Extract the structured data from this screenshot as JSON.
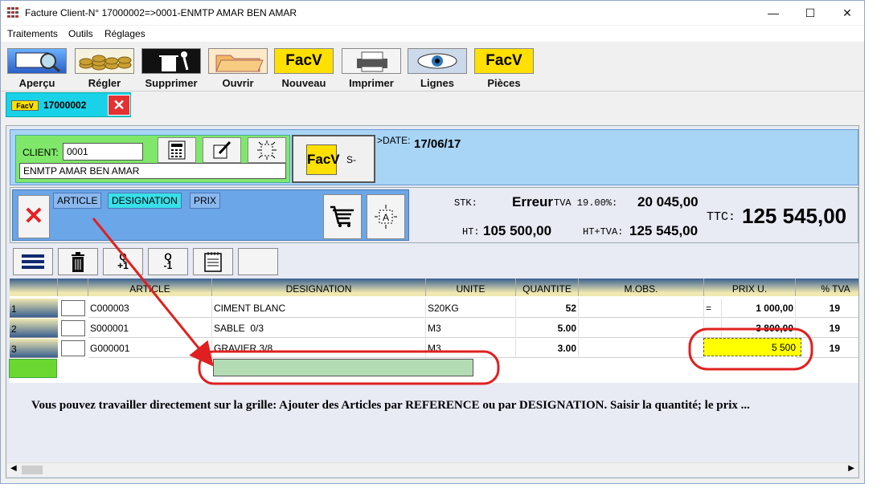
{
  "window": {
    "title": "Facture Client-N° 17000002=>0001-ENMTP AMAR BEN AMAR",
    "minimize": "—",
    "maximize": "☐",
    "close": "✕"
  },
  "menu": [
    "Traitements",
    "Outils",
    "Réglages"
  ],
  "toolbar": [
    {
      "label": "Aperçu",
      "icon": "magnifier-icon"
    },
    {
      "label": "Régler",
      "icon": "coins-icon"
    },
    {
      "label": "Supprimer",
      "icon": "trash-icon"
    },
    {
      "label": "Ouvrir",
      "icon": "folder-icon"
    },
    {
      "label": "Nouveau",
      "icon": "facv-icon",
      "badge": "FacV"
    },
    {
      "label": "Imprimer",
      "icon": "printer-icon"
    },
    {
      "label": "Lignes",
      "icon": "eye-icon"
    },
    {
      "label": "Pièces",
      "icon": "facv-icon",
      "badge": "FacV"
    }
  ],
  "doc_tab": {
    "badge": "FacV",
    "label": "17000002",
    "close": "✕"
  },
  "client": {
    "label": "CLIENT:",
    "code": "0001",
    "name": "ENMTP AMAR BEN AMAR",
    "facv_badge": "FacV",
    "facv_suffix": "S-",
    "date_label": ">DATE:",
    "date_value": "17/06/17"
  },
  "search_tabs": [
    "ARTICLE",
    "DESIGNATION",
    "PRIX"
  ],
  "totals": {
    "stk_label": "STK:",
    "stk_value": "Erreur",
    "tva_label": "TVA 19.00%:",
    "tva_value": "20 045,00",
    "ht_label": "HT:",
    "ht_value": "105 500,00",
    "ht_tva_label": "HT+TVA:",
    "ht_tva_value": "125 545,00",
    "ttc_label": "TTC:",
    "ttc_value": "125 545,00"
  },
  "grid_buttons": {
    "qplus": "Q\n+1",
    "qminus": "Q\n-1"
  },
  "grid": {
    "columns": [
      "ARTICLE",
      "DESIGNATION",
      "UNITE",
      "QUANTITE",
      "M.OBS.",
      "PRIX U.",
      "% TVA"
    ],
    "rows": [
      {
        "num": "1",
        "article": "C000003",
        "designation": "CIMENT BLANC",
        "unite": "S20KG",
        "quantite": "52",
        "prix_mark": "=",
        "prix": "1 000,00",
        "tva": "19"
      },
      {
        "num": "2",
        "article": "S000001",
        "designation": "SABLE  0/3",
        "unite": "M3",
        "quantite": "5.00",
        "prix_mark": "",
        "prix": "3 800,00",
        "tva": "19"
      },
      {
        "num": "3",
        "article": "G000001",
        "designation": "GRAVIER 3/8",
        "unite": "M3",
        "quantite": "3.00",
        "prix_mark": "",
        "prix": "5 500",
        "tva": "19"
      }
    ]
  },
  "help_text": "Vous pouvez travailler directement sur la grille: Ajouter des Articles par REFERENCE ou par DESIGNATION. Saisir la quantité; le prix ...",
  "colors": {
    "accent_cyan": "#19d2e8",
    "client_green": "#7fe86a",
    "article_blue": "#6aa6e8",
    "highlight": "#ffff00",
    "annotation_red": "#e02020"
  }
}
